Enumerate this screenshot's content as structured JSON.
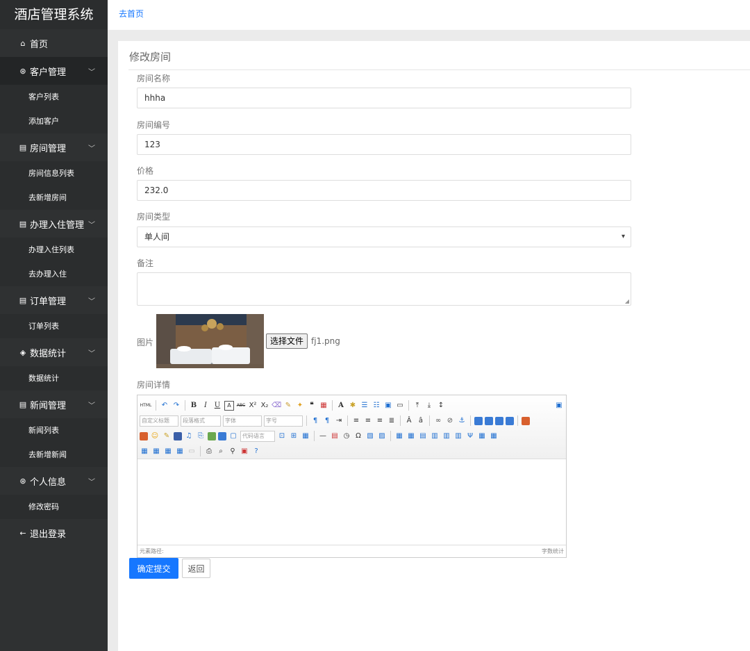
{
  "sidebar": {
    "brand": "酒店管理系统",
    "home": "首页",
    "groups": [
      {
        "label": "客户管理",
        "items": [
          "客户列表",
          "添加客户"
        ]
      },
      {
        "label": "房间管理",
        "items": [
          "房间信息列表",
          "去新增房间"
        ]
      },
      {
        "label": "办理入住管理",
        "items": [
          "办理入住列表",
          "去办理入住"
        ]
      },
      {
        "label": "订单管理",
        "items": [
          "订单列表"
        ]
      },
      {
        "label": "数据统计",
        "items": [
          "数据统计"
        ]
      },
      {
        "label": "新闻管理",
        "items": [
          "新闻列表",
          "去新增新闻"
        ]
      },
      {
        "label": "个人信息",
        "items": [
          "修改密码"
        ]
      }
    ],
    "logout": "退出登录"
  },
  "breadcrumb": {
    "home_link": "去首页"
  },
  "panel": {
    "title": "修改房间"
  },
  "form": {
    "name_label": "房间名称",
    "name_value": "hhha",
    "number_label": "房间编号",
    "number_value": "123",
    "price_label": "价格",
    "price_value": "232.0",
    "type_label": "房间类型",
    "type_value": "单人间",
    "remark_label": "备注",
    "remark_value": "",
    "image_label": "图片",
    "file_button": "选择文件",
    "file_name": "fj1.png",
    "detail_label": "房间详情"
  },
  "editor": {
    "toolbar": {
      "html": "HTML",
      "combo_custom_title": "自定义标题",
      "combo_paragraph": "段落格式",
      "combo_font": "字体",
      "combo_size": "字号",
      "combo_code": "代码语言"
    },
    "status_left": "元素路径:",
    "status_right": "字数统计"
  },
  "actions": {
    "submit": "确定提交",
    "back": "返回"
  },
  "colors": {
    "sidebar": "#2f3132",
    "accent": "#1677ff"
  }
}
